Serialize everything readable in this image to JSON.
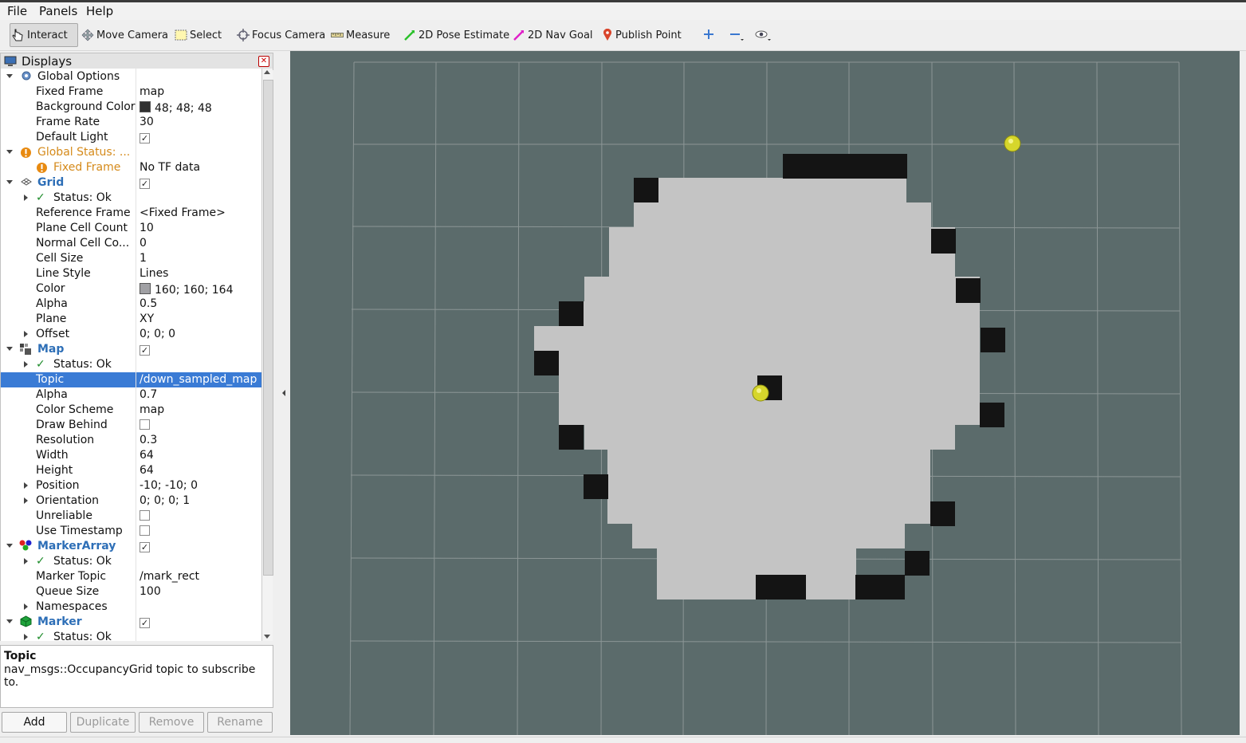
{
  "menu": [
    "File",
    "Panels",
    "Help"
  ],
  "toolbar": {
    "interact": "Interact",
    "move_camera": "Move Camera",
    "select": "Select",
    "focus_camera": "Focus Camera",
    "measure": "Measure",
    "pose_estimate": "2D Pose Estimate",
    "nav_goal": "2D Nav Goal",
    "publish_point": "Publish Point"
  },
  "panel": {
    "title": "Displays"
  },
  "tree": {
    "global_options": "Global Options",
    "fixed_frame": "Fixed Frame",
    "fixed_frame_val": "map",
    "bg_color": "Background Color",
    "bg_color_val": "48; 48; 48",
    "frame_rate": "Frame Rate",
    "frame_rate_val": "30",
    "default_light": "Default Light",
    "global_status": "Global Status: ...",
    "gs_fixed_frame": "Fixed Frame",
    "gs_fixed_frame_val": "No TF data",
    "grid": "Grid",
    "status_ok": "Status: Ok",
    "reference_frame": "Reference Frame",
    "reference_frame_val": "<Fixed Frame>",
    "plane_cell_count": "Plane Cell Count",
    "plane_cell_count_val": "10",
    "normal_cell_count": "Normal Cell Co...",
    "normal_cell_count_val": "0",
    "cell_size": "Cell Size",
    "cell_size_val": "1",
    "line_style": "Line Style",
    "line_style_val": "Lines",
    "color": "Color",
    "color_val": "160; 160; 164",
    "alpha": "Alpha",
    "grid_alpha_val": "0.5",
    "plane": "Plane",
    "plane_val": "XY",
    "offset": "Offset",
    "offset_val": "0; 0; 0",
    "map": "Map",
    "topic": "Topic",
    "topic_val": "/down_sampled_map",
    "map_alpha_val": "0.7",
    "color_scheme": "Color Scheme",
    "color_scheme_val": "map",
    "draw_behind": "Draw Behind",
    "resolution": "Resolution",
    "resolution_val": "0.3",
    "width": "Width",
    "width_val": "64",
    "height": "Height",
    "height_val": "64",
    "position": "Position",
    "position_val": "-10; -10; 0",
    "orientation": "Orientation",
    "orientation_val": "0; 0; 0; 1",
    "unreliable": "Unreliable",
    "use_timestamp": "Use Timestamp",
    "marker_array": "MarkerArray",
    "marker_topic": "Marker Topic",
    "marker_topic_val": "/mark_rect",
    "queue_size": "Queue Size",
    "queue_size_val": "100",
    "namespaces": "Namespaces",
    "marker": "Marker"
  },
  "description": {
    "title": "Topic",
    "body": "nav_msgs::OccupancyGrid topic to subscribe to."
  },
  "buttons": {
    "add": "Add",
    "duplicate": "Duplicate",
    "remove": "Remove",
    "rename": "Rename"
  },
  "colors": {
    "viewport_bg": "#5b6b6b",
    "free_cell": "#c4c4c4",
    "occupied_cell": "#111111",
    "marker": "#d8d830",
    "selection": "#3a7bd5"
  }
}
